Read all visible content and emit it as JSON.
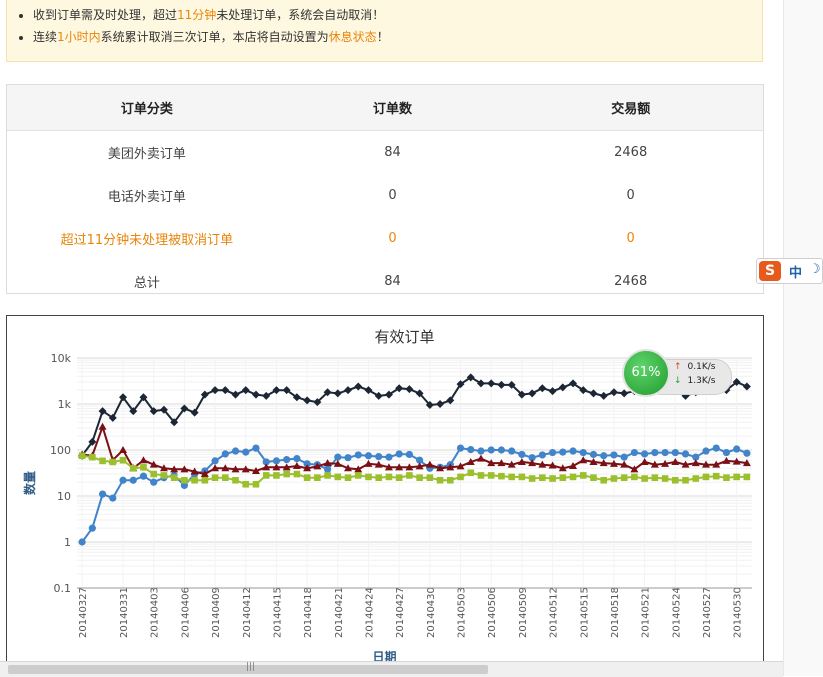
{
  "notice": {
    "line1_pre": "收到订单需及时处理，超过",
    "line1_hl": "11分钟",
    "line1_post": "未处理订单，系统会自动取消！",
    "line2_pre": "连续",
    "line2_hl1": "1小时内",
    "line2_mid": "系统累计取消三次订单，本店将自动设置为",
    "line2_hl2": "休息状态",
    "line2_post": "！"
  },
  "summary": {
    "headers": [
      "订单分类",
      "订单数",
      "交易额"
    ],
    "rows": [
      {
        "category": "美团外卖订单",
        "count": "84",
        "amount": "2468"
      },
      {
        "category": "电话外卖订单",
        "count": "0",
        "amount": "0"
      },
      {
        "category": "超过11分钟未处理被取消订单",
        "count": "0",
        "amount": "0"
      },
      {
        "category": "总计",
        "count": "84",
        "amount": "2468"
      }
    ]
  },
  "ime": {
    "logo": "S",
    "mode": "中"
  },
  "net_monitor": {
    "percent": "61%",
    "up": "0.1K/s",
    "down": "1.3K/s"
  },
  "chart_data": {
    "type": "line",
    "title": "有效订单",
    "xlabel": "日期",
    "ylabel": "数量",
    "yscale": "log",
    "ylim": [
      0.1,
      10000
    ],
    "yticks": [
      "0.1",
      "1",
      "10",
      "100",
      "1k",
      "10k"
    ],
    "grid": true,
    "x": [
      "20140327",
      "20140328",
      "20140329",
      "20140330",
      "20140331",
      "20140401",
      "20140402",
      "20140403",
      "20140404",
      "20140405",
      "20140406",
      "20140407",
      "20140408",
      "20140409",
      "20140410",
      "20140411",
      "20140412",
      "20140413",
      "20140414",
      "20140415",
      "20140416",
      "20140417",
      "20140418",
      "20140419",
      "20140420",
      "20140421",
      "20140422",
      "20140423",
      "20140424",
      "20140425",
      "20140426",
      "20140427",
      "20140428",
      "20140429",
      "20140430",
      "20140501",
      "20140502",
      "20140503",
      "20140504",
      "20140505",
      "20140506",
      "20140507",
      "20140508",
      "20140509",
      "20140510",
      "20140511",
      "20140512",
      "20140513",
      "20140514",
      "20140515",
      "20140516",
      "20140517",
      "20140518",
      "20140519",
      "20140520",
      "20140521",
      "20140522",
      "20140523",
      "20140524",
      "20140525",
      "20140526",
      "20140527",
      "20140528",
      "20140529",
      "20140530",
      "20140531"
    ],
    "xticks": [
      "20140327",
      "20140331",
      "20140403",
      "20140406",
      "20140409",
      "20140412",
      "20140415",
      "20140418",
      "20140421",
      "20140424",
      "20140427",
      "20140430",
      "20140503",
      "20140506",
      "20140509",
      "20140512",
      "20140515",
      "20140518",
      "20140521",
      "20140524",
      "20140527",
      "20140530"
    ],
    "series": [
      {
        "color": "#1c2634",
        "marker": "diamond",
        "values": [
          75,
          150,
          700,
          500,
          1400,
          700,
          1400,
          700,
          750,
          400,
          800,
          650,
          1600,
          2000,
          2000,
          1600,
          2000,
          1600,
          1500,
          2000,
          2000,
          1400,
          1200,
          1100,
          1800,
          1700,
          2000,
          2400,
          2000,
          1500,
          1600,
          2200,
          2100,
          1700,
          950,
          1000,
          1200,
          2700,
          3800,
          2800,
          2800,
          2600,
          2600,
          1600,
          1700,
          2200,
          1900,
          2300,
          2800,
          2000,
          1700,
          1500,
          1800,
          1700,
          1900,
          2200,
          2000,
          2300,
          2000,
          1500,
          1800,
          2000,
          2300,
          2000,
          3000,
          2400
        ]
      },
      {
        "color": "#4184c9",
        "marker": "circle",
        "values": [
          1,
          2,
          11,
          9,
          22,
          22,
          27,
          20,
          25,
          28,
          17,
          30,
          35,
          58,
          82,
          95,
          90,
          110,
          55,
          58,
          62,
          65,
          50,
          48,
          38,
          70,
          68,
          78,
          75,
          72,
          70,
          82,
          80,
          60,
          40,
          42,
          48,
          110,
          102,
          95,
          100,
          100,
          95,
          80,
          68,
          78,
          88,
          90,
          95,
          88,
          80,
          75,
          78,
          70,
          88,
          82,
          88,
          88,
          88,
          82,
          70,
          95,
          110,
          88,
          105,
          85
        ]
      },
      {
        "color": "#7a1016",
        "marker": "triangle",
        "values": [
          80,
          75,
          320,
          60,
          100,
          40,
          60,
          48,
          40,
          38,
          38,
          34,
          30,
          40,
          40,
          38,
          38,
          35,
          42,
          42,
          42,
          45,
          40,
          44,
          52,
          50,
          40,
          38,
          50,
          48,
          42,
          42,
          42,
          44,
          48,
          40,
          42,
          44,
          55,
          65,
          52,
          52,
          48,
          55,
          52,
          48,
          46,
          40,
          45,
          60,
          55,
          52,
          50,
          48,
          38,
          55,
          48,
          50,
          55,
          48,
          52,
          48,
          48,
          58,
          56,
          52
        ]
      },
      {
        "color": "#9cbf2e",
        "marker": "square",
        "values": [
          75,
          70,
          58,
          55,
          60,
          40,
          42,
          30,
          28,
          25,
          22,
          22,
          22,
          25,
          25,
          22,
          18,
          18,
          28,
          28,
          30,
          30,
          25,
          25,
          28,
          26,
          25,
          28,
          26,
          25,
          26,
          25,
          28,
          25,
          25,
          22,
          22,
          26,
          32,
          28,
          28,
          27,
          26,
          26,
          24,
          25,
          24,
          25,
          26,
          28,
          25,
          22,
          24,
          25,
          26,
          24,
          25,
          24,
          22,
          22,
          24,
          26,
          27,
          25,
          26,
          26
        ]
      }
    ]
  }
}
